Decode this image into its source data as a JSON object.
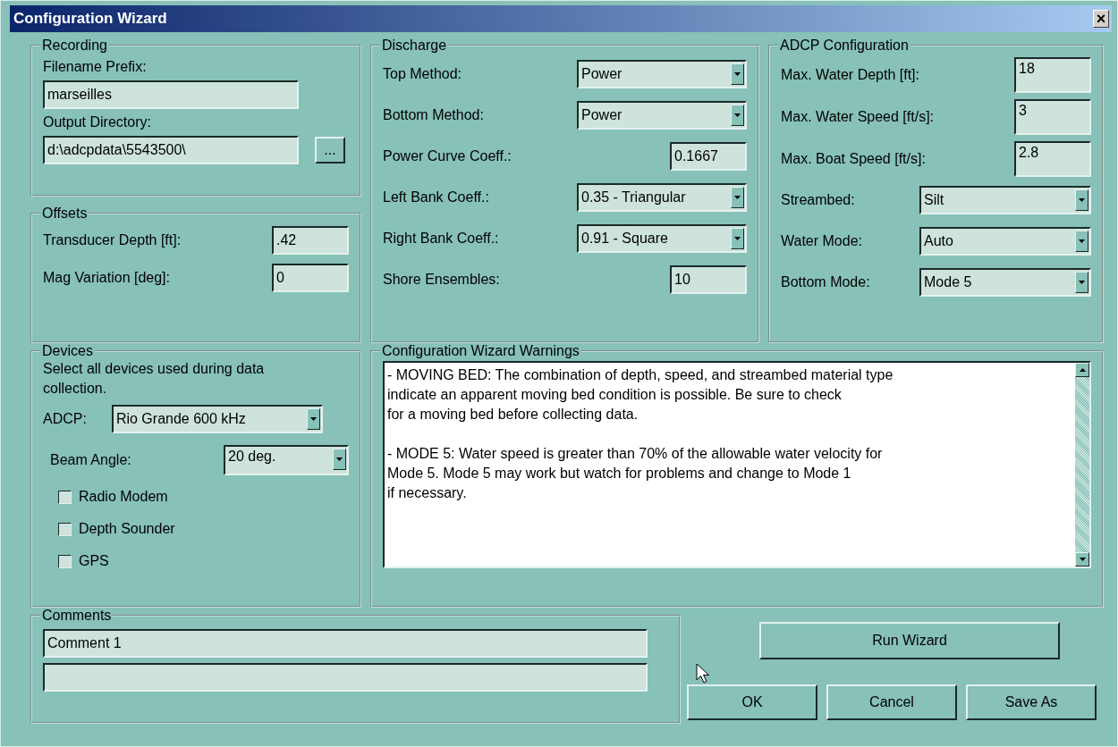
{
  "window": {
    "title": "Configuration Wizard",
    "close": "×"
  },
  "recording": {
    "title": "Recording",
    "fields": [
      {
        "label": "Filename Prefix:",
        "value": "marseilles"
      },
      {
        "label": "Output Directory:",
        "value": "d:\\adcpdata\\5543500\\",
        "browse": "..."
      }
    ]
  },
  "offsets": {
    "title": "Offsets",
    "rows": [
      {
        "kind": "text",
        "label": "Transducer Depth [ft]:",
        "value": ".42"
      },
      {
        "kind": "text",
        "label": "Mag Variation [deg]:",
        "value": "0"
      }
    ]
  },
  "discharge": {
    "title": "Discharge",
    "rows": [
      {
        "kind": "dropdown",
        "label": "Top Method:",
        "value": "Power"
      },
      {
        "kind": "dropdown",
        "label": "Bottom Method:",
        "value": "Power"
      },
      {
        "kind": "text",
        "label": "Power Curve Coeff.:",
        "value": "0.1667"
      },
      {
        "kind": "dropdown",
        "label": "Left Bank Coeff.:",
        "value": "0.35 - Triangular"
      },
      {
        "kind": "dropdown",
        "label": "Right Bank Coeff.:",
        "value": "0.91 - Square"
      },
      {
        "kind": "text",
        "label": "Shore Ensembles:",
        "value": "10"
      }
    ]
  },
  "adcp": {
    "title": "ADCP Configuration",
    "rows": [
      {
        "kind": "text",
        "label": "Max. Water Depth [ft]:",
        "value": "18"
      },
      {
        "kind": "text",
        "label": "Max. Water Speed [ft/s]:",
        "value": "3"
      },
      {
        "kind": "text",
        "label": "Max. Boat Speed [ft/s]:",
        "value": "2.8"
      },
      {
        "kind": "dropdown",
        "label": "Streambed:",
        "value": "Silt"
      },
      {
        "kind": "dropdown",
        "label": "Water Mode:",
        "value": "Auto"
      },
      {
        "kind": "dropdown",
        "label": "Bottom Mode:",
        "value": "Mode 5"
      }
    ]
  },
  "devices": {
    "title": "Devices",
    "instructions": "Select all devices used during data collection.",
    "rows": [
      {
        "kind": "dropdown",
        "label": "ADCP:",
        "value": "Rio Grande 600 kHz"
      },
      {
        "kind": "dropdown",
        "label": "Beam Angle:",
        "value": "20 deg."
      }
    ],
    "checkboxes": [
      {
        "label": "Radio Modem",
        "checked": false
      },
      {
        "label": "Depth Sounder",
        "checked": false
      },
      {
        "label": "GPS",
        "checked": false
      }
    ]
  },
  "warnings": {
    "title": "Configuration Wizard Warnings",
    "messages": [
      "- MOVING BED: The combination of depth, speed, and streambed material type\n indicate an apparent moving bed condition is possible.  Be sure to check\n for a moving bed before collecting data.",
      "- MODE 5: Water speed is greater than 70% of the allowable water velocity for\n Mode 5. Mode 5 may work but watch for problems and change to Mode 1\n if necessary."
    ]
  },
  "comments": {
    "title": "Comments",
    "fields": [
      {
        "kind": "filled",
        "value": "Comment 1"
      },
      {
        "kind": "blank"
      }
    ]
  },
  "buttons": {
    "run": "Run Wizard",
    "actions": [
      "OK",
      "Cancel",
      "Save As"
    ]
  }
}
